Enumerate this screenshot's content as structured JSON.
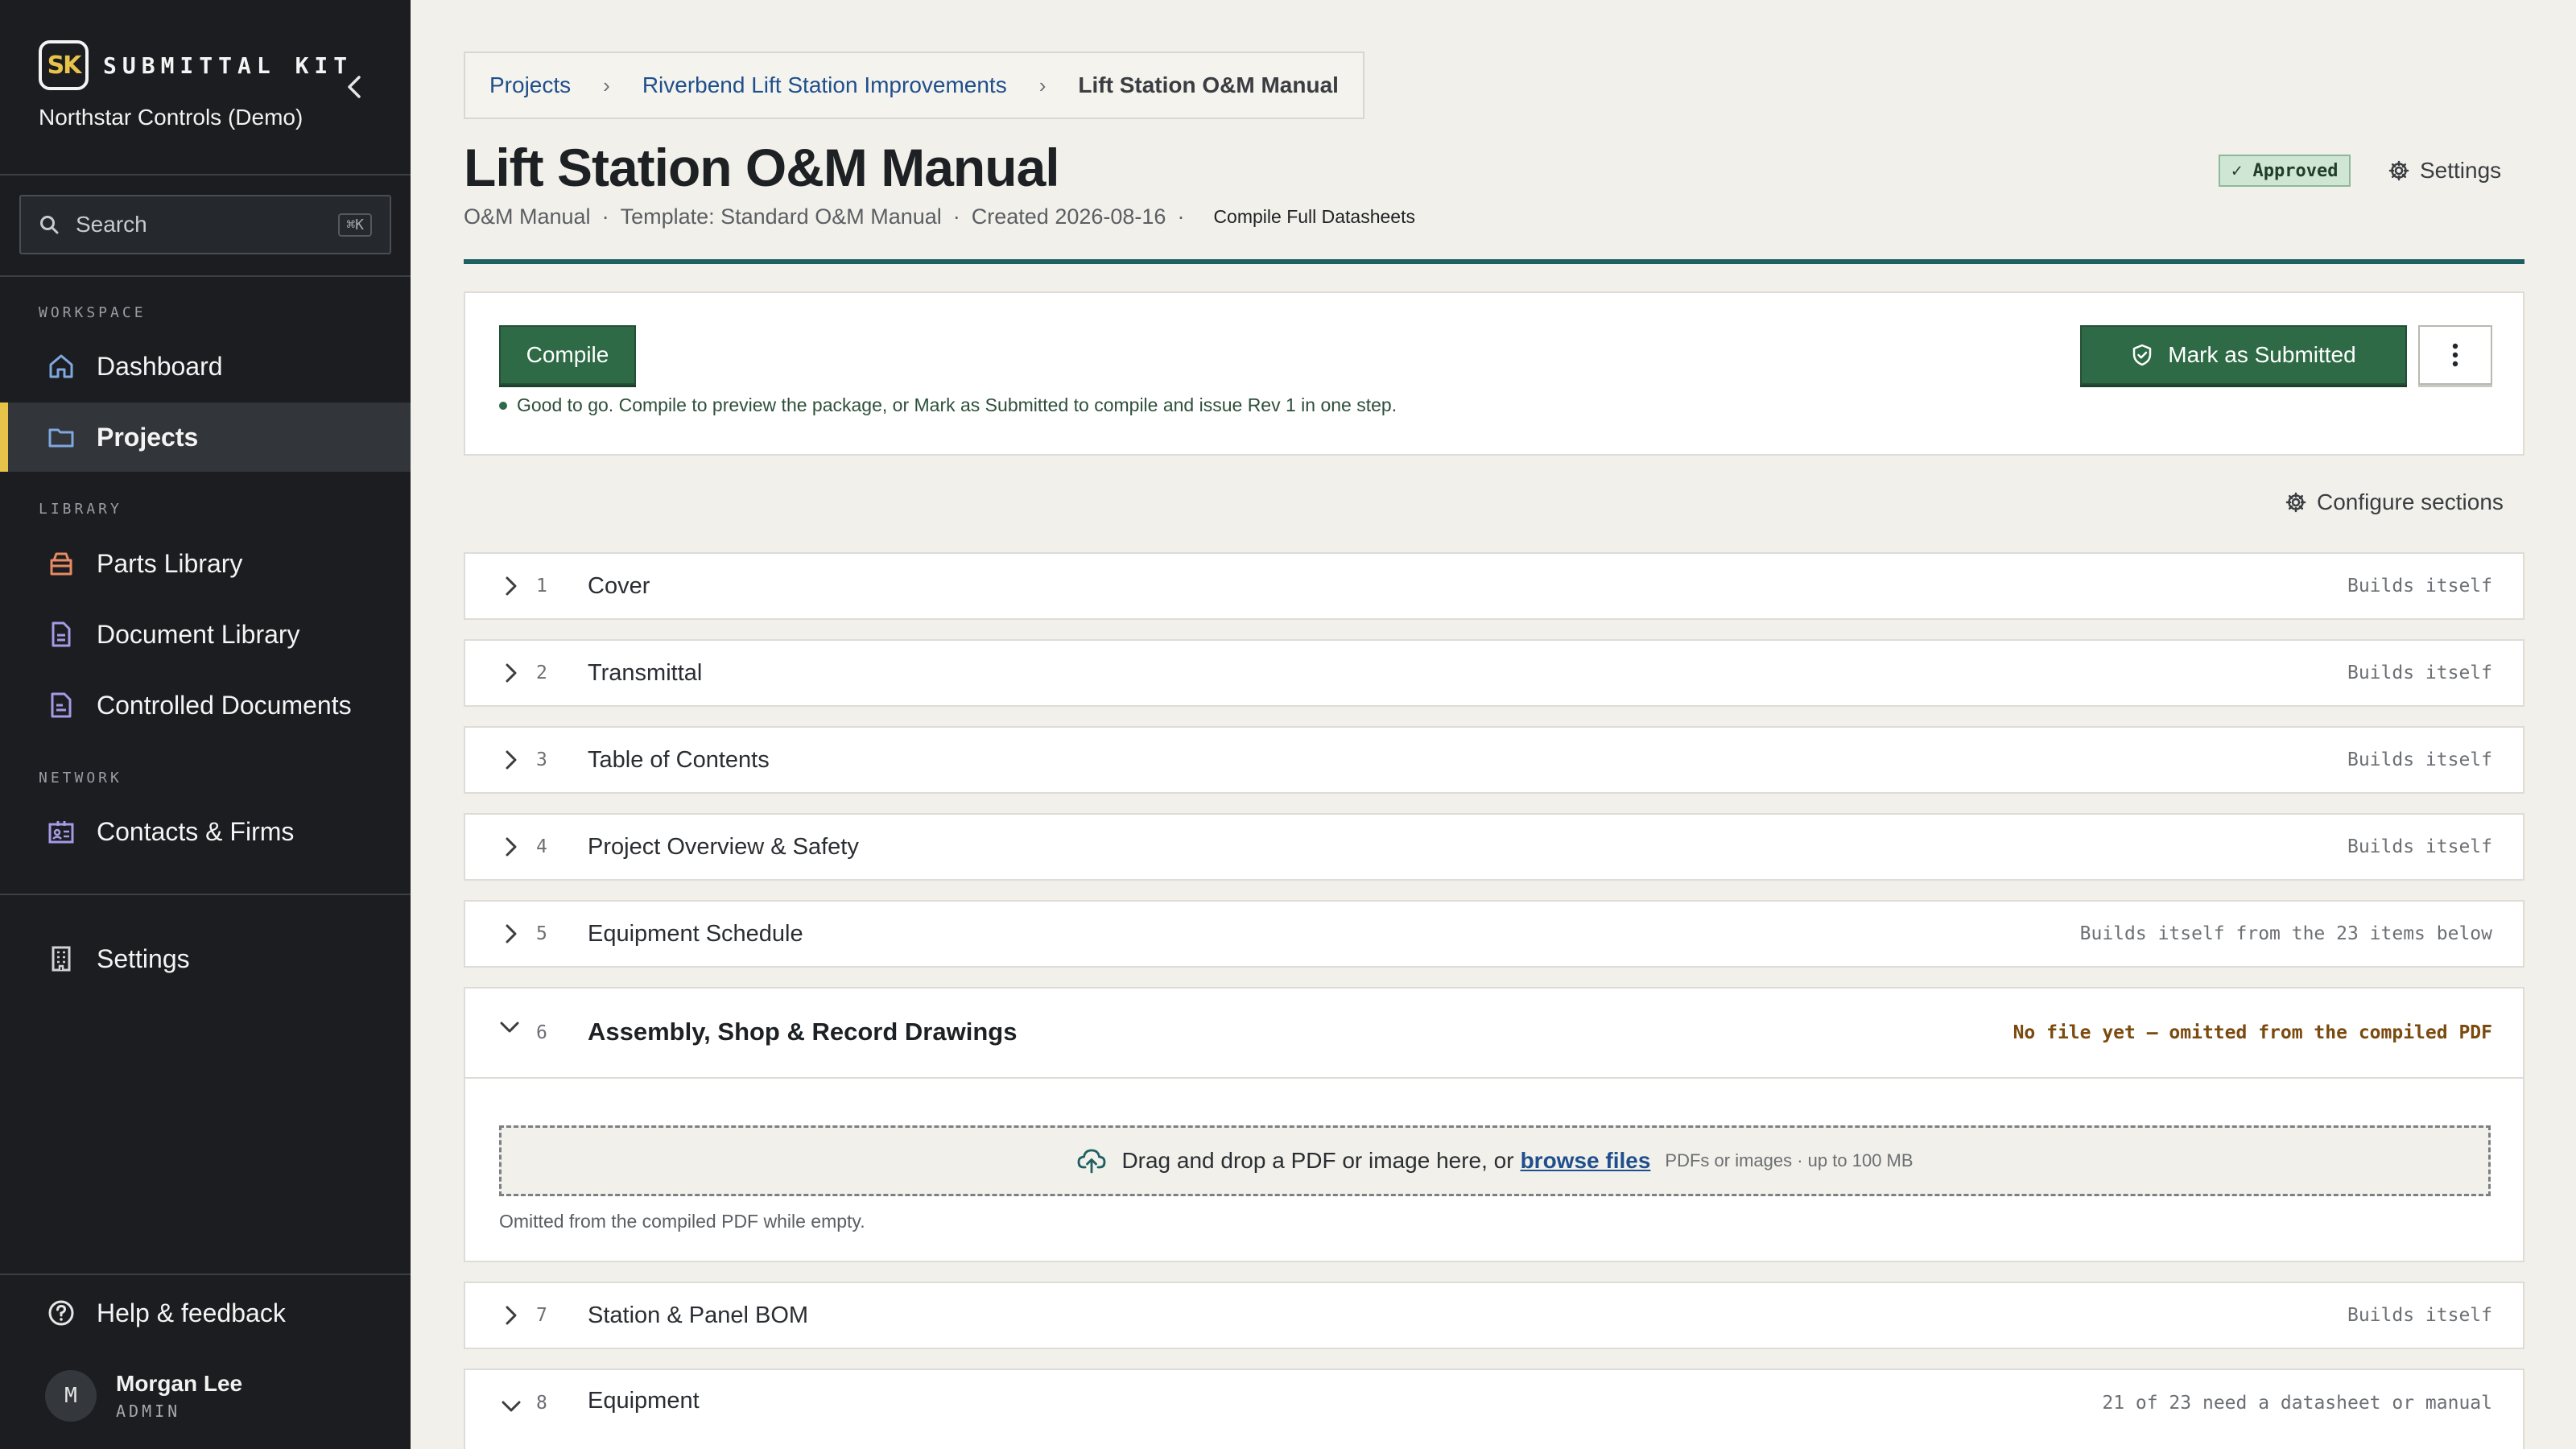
{
  "app": {
    "logo_text": "SK",
    "name": "SUBMITTAL KIT",
    "org": "Northstar Controls (Demo)"
  },
  "search": {
    "placeholder": "Search",
    "shortcut": "⌘K"
  },
  "sidebar": {
    "workspace_label": "WORKSPACE",
    "library_label": "LIBRARY",
    "network_label": "NETWORK",
    "items": [
      {
        "label": "Dashboard",
        "icon": "home-icon"
      },
      {
        "label": "Projects",
        "icon": "folder-icon",
        "active": true
      },
      {
        "label": "Parts Library",
        "icon": "box-icon"
      },
      {
        "label": "Document Library",
        "icon": "document-icon"
      },
      {
        "label": "Controlled Documents",
        "icon": "controlled-document-icon"
      },
      {
        "label": "Contacts & Firms",
        "icon": "contact-card-icon"
      },
      {
        "label": "Settings",
        "icon": "building-icon"
      }
    ],
    "help": "Help & feedback",
    "user": {
      "initial": "M",
      "name": "Morgan Lee",
      "role": "ADMIN"
    }
  },
  "breadcrumb": {
    "items": [
      "Projects",
      "Riverbend Lift Station Improvements",
      "Lift Station O&M Manual"
    ]
  },
  "page": {
    "title": "Lift Station O&M Manual",
    "type": "O&M Manual",
    "template": "Template: Standard O&M Manual",
    "created": "Created 2026-08-16",
    "compile_full": "Compile Full Datasheets",
    "status": "✓ Approved",
    "settings": "Settings"
  },
  "actions": {
    "compile": "Compile",
    "status_message": "Good to go. Compile to preview the package, or Mark as Submitted to compile and issue Rev 1 in one step.",
    "mark_submitted": "Mark as Submitted"
  },
  "configure_sections": "Configure sections",
  "sections": [
    {
      "num": "1",
      "title": "Cover",
      "status": "Builds itself"
    },
    {
      "num": "2",
      "title": "Transmittal",
      "status": "Builds itself"
    },
    {
      "num": "3",
      "title": "Table of Contents",
      "status": "Builds itself"
    },
    {
      "num": "4",
      "title": "Project Overview & Safety",
      "status": "Builds itself"
    },
    {
      "num": "5",
      "title": "Equipment Schedule",
      "status": "Builds itself from the 23 items below"
    },
    {
      "num": "6",
      "title": "Assembly, Shop & Record Drawings",
      "status": "No file yet — omitted from the compiled PDF"
    },
    {
      "num": "7",
      "title": "Station & Panel BOM",
      "status": "Builds itself"
    },
    {
      "num": "8",
      "title": "Equipment",
      "status": "21 of 23 need a datasheet or manual"
    }
  ],
  "dropzone": {
    "text": "Drag and drop a PDF or image here, or",
    "browse": "browse files",
    "hint": "PDFs or images · up to 100 MB",
    "note": "Omitted from the compiled PDF while empty."
  },
  "colors": {
    "sidebar_bg": "#1b1d20",
    "accent_yellow": "#e8c34a",
    "primary_green": "#2d6a45",
    "link_blue": "#1f4f8c",
    "teal_rule": "#1f5f63",
    "warning_text": "#7a4a0e"
  }
}
